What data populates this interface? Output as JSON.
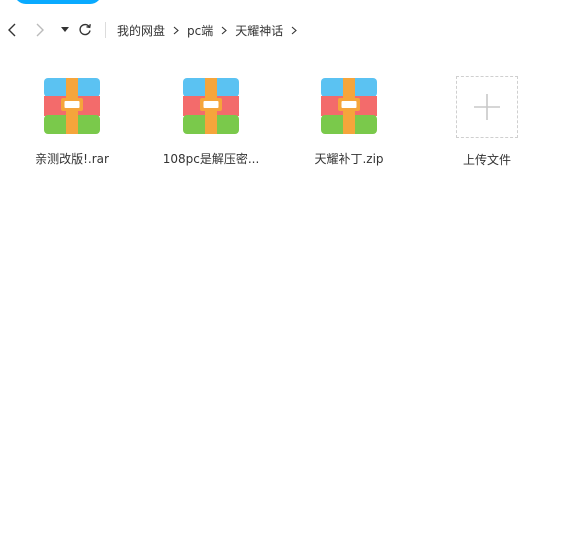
{
  "toolbar": {
    "back_icon": "chevron-left-icon",
    "forward_icon": "chevron-right-icon",
    "dropdown_icon": "caret-down-icon",
    "refresh_icon": "refresh-icon"
  },
  "breadcrumb": {
    "items": [
      {
        "label": "我的网盘"
      },
      {
        "label": "pc端"
      },
      {
        "label": "天耀神话"
      }
    ],
    "separator_icon": "chevron-right-icon"
  },
  "files": [
    {
      "name": "亲测改版!.rar",
      "icon": "archive-icon"
    },
    {
      "name": "108pc是解压密...",
      "icon": "archive-icon"
    },
    {
      "name": "天耀补丁.zip",
      "icon": "archive-icon"
    }
  ],
  "upload": {
    "label": "上传文件",
    "icon": "plus-icon"
  },
  "colors": {
    "accent": "#09AAFF",
    "archive_blue": "#5BC2F2",
    "archive_red": "#F36B6B",
    "archive_green": "#7AC94B",
    "archive_strap": "#F5A53B"
  }
}
